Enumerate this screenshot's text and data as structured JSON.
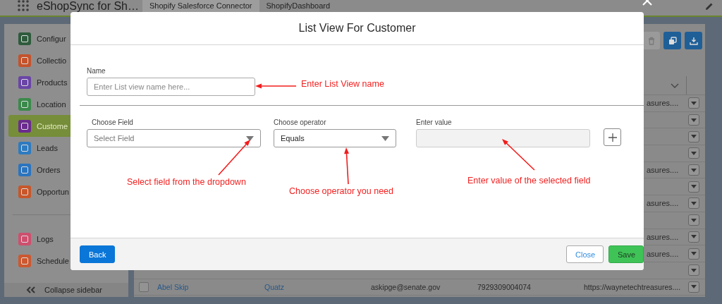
{
  "app_header": {
    "title": "eShopSync for Sh…",
    "tabs": [
      {
        "label": "Shopify Salesforce Connector",
        "selected": true
      },
      {
        "label": "ShopifyDashboard",
        "selected": false
      }
    ]
  },
  "sidebar": {
    "items": [
      {
        "label": "Configur",
        "color": "#2e5b3c",
        "selected": false
      },
      {
        "label": "Collectio",
        "color": "#c4532c",
        "selected": false
      },
      {
        "label": "Products",
        "color": "#6a45a6",
        "selected": false
      },
      {
        "label": "Location",
        "color": "#3b8a4b",
        "selected": false
      },
      {
        "label": "Custome",
        "color": "#6b2b8e",
        "selected": true
      },
      {
        "label": "Leads",
        "color": "#2d7bc0",
        "selected": false
      },
      {
        "label": "Orders",
        "color": "#2b74bf",
        "selected": false
      },
      {
        "label": "Opportun",
        "color": "#c7572b",
        "selected": false
      }
    ],
    "footer_items": [
      {
        "label": "Logs",
        "color": "#cf4f6e",
        "selected": false
      },
      {
        "label": "Schedule",
        "color": "#cc5930",
        "selected": false
      }
    ],
    "collapse_label": "Collapse sidebar"
  },
  "toolbar": [
    {
      "kind": "trash",
      "disabled": true
    },
    {
      "kind": "copy",
      "disabled": false
    },
    {
      "kind": "download",
      "disabled": false
    }
  ],
  "table": {
    "rows": [
      {
        "kind": "covered",
        "website": "asures...."
      },
      {
        "kind": "covered"
      },
      {
        "kind": "covered"
      },
      {
        "kind": "covered"
      },
      {
        "kind": "covered",
        "website": "asures...."
      },
      {
        "kind": "covered"
      },
      {
        "kind": "covered",
        "website": "asures...."
      },
      {
        "kind": "covered"
      },
      {
        "kind": "covered",
        "website": "asures...."
      },
      {
        "kind": "covered",
        "website": "asures...."
      },
      {
        "kind": "covered"
      },
      {
        "kind": "full",
        "checked": false,
        "name": "Abel Skip",
        "account": "Quatz",
        "email": "askipge@senate.gov",
        "phone": "7929309004074",
        "website": "https://waynetechtreasures...."
      }
    ]
  },
  "modal": {
    "title": "List View For Customer",
    "name_field": {
      "label": "Name",
      "placeholder": "Enter List view name here..."
    },
    "conditions": {
      "field": {
        "label": "Choose Field",
        "placeholder": "Select Field"
      },
      "operator": {
        "label": "Choose operator",
        "value": "Equals"
      },
      "value": {
        "label": "Enter value",
        "disabled": true
      }
    },
    "annotations": [
      "Enter List View name",
      "Select field from the dropdown",
      "Choose operator you need",
      "Enter value of the selected field"
    ],
    "buttons": {
      "back": "Back",
      "close": "Close",
      "save": "Save"
    }
  }
}
